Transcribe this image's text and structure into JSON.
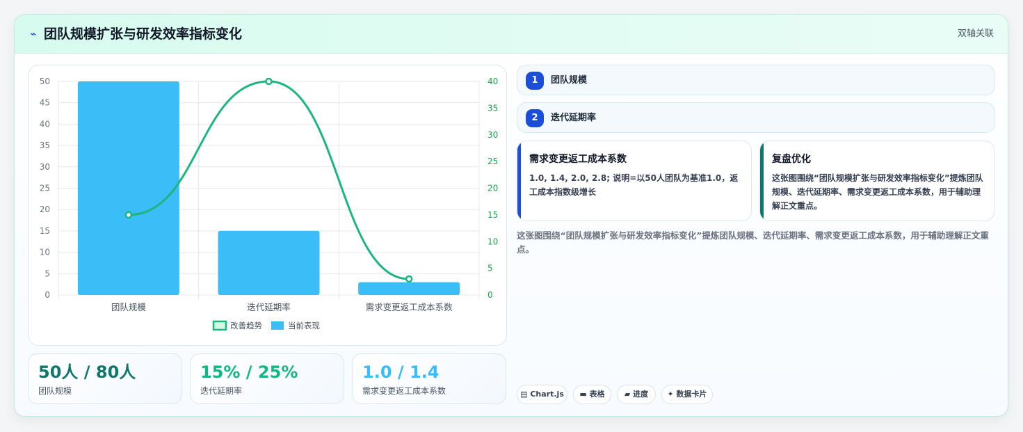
{
  "header": {
    "icon": "bolt-icon",
    "title": "团队规模扩张与研发效率指标变化",
    "tag": "双轴关联"
  },
  "chart_data": {
    "type": "bar",
    "categories": [
      "团队规模",
      "迭代延期率",
      "需求变更返工成本系数"
    ],
    "series": [
      {
        "name": "当前表现",
        "type": "bar",
        "axis": "left",
        "values": [
          50,
          15,
          3
        ],
        "color": "#3bbdf8"
      },
      {
        "name": "改善趋势",
        "type": "line",
        "axis": "right",
        "values": [
          15,
          40,
          3
        ],
        "color": "#1bb67e"
      }
    ],
    "y_left": {
      "min": 0,
      "max": 50,
      "step": 5
    },
    "y_right": {
      "min": 0,
      "max": 40,
      "step": 5
    },
    "legend_position": "bottom",
    "grid": true
  },
  "stats": [
    {
      "value": "50人 / 80人",
      "label": "团队规模",
      "color": "#0f766e"
    },
    {
      "value": "15% / 25%",
      "label": "迭代延期率",
      "color": "#10b981"
    },
    {
      "value": "1.0 / 1.4",
      "label": "需求变更返工成本系数",
      "color": "#38bdf8"
    }
  ],
  "steps": [
    {
      "num": "1",
      "label": "团队规模"
    },
    {
      "num": "2",
      "label": "迭代延期率"
    }
  ],
  "info_cards": [
    {
      "title": "需求变更返工成本系数",
      "text": "1.0, 1.4, 2.0, 2.8; 说明=以50人团队为基准1.0，返工成本指数级增长",
      "accent": "#1d4ed8"
    },
    {
      "title": "复盘优化",
      "text": "这张图围绕“团队规模扩张与研发效率指标变化”提炼团队规模、迭代延期率、需求变更返工成本系数，用于辅助理解正文重点。",
      "accent": "#0f766e"
    }
  ],
  "description": "这张图围绕“团队规模扩张与研发效率指标变化”提炼团队规模、迭代延期率、需求变更返工成本系数，用于辅助理解正文重点。",
  "chips": [
    {
      "icon": "chart-icon",
      "glyph": "▤",
      "label": "Chart.js"
    },
    {
      "icon": "table-icon",
      "glyph": "▬",
      "label": "表格"
    },
    {
      "icon": "progress-icon",
      "glyph": "▰",
      "label": "进度"
    },
    {
      "icon": "sparkle-icon",
      "glyph": "✦",
      "label": "数据卡片"
    }
  ]
}
